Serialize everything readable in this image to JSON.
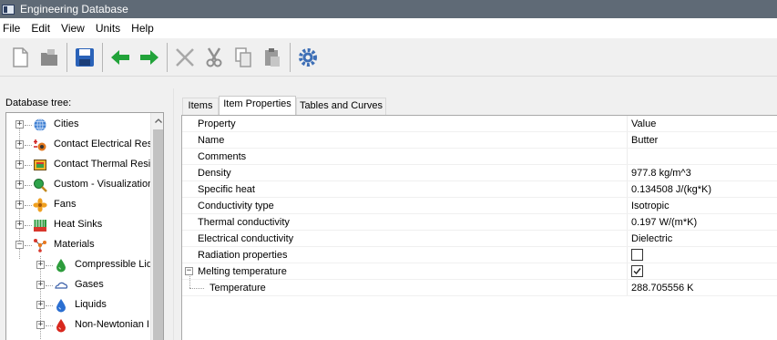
{
  "window": {
    "title": "Engineering Database"
  },
  "menu": {
    "items": [
      "File",
      "Edit",
      "View",
      "Units",
      "Help"
    ]
  },
  "toolbar": {
    "buttons": [
      "new-document-icon",
      "open-folder-icon",
      "save-icon",
      "back-arrow-icon",
      "forward-arrow-icon",
      "delete-icon",
      "cut-icon",
      "copy-icon",
      "paste-icon",
      "settings-gear-icon"
    ]
  },
  "tree": {
    "label": "Database tree:",
    "items": [
      {
        "label": "Cities",
        "icon": "globe-icon"
      },
      {
        "label": "Contact Electrical Res",
        "icon": "contact-electrical-icon"
      },
      {
        "label": "Contact Thermal Resi",
        "icon": "contact-thermal-icon"
      },
      {
        "label": "Custom - Visualization",
        "icon": "magnifier-icon"
      },
      {
        "label": "Fans",
        "icon": "fan-icon"
      },
      {
        "label": "Heat Sinks",
        "icon": "heat-sink-icon"
      },
      {
        "label": "Materials",
        "icon": "materials-icon"
      },
      {
        "label": "Compressible Liq",
        "icon": "green-drop-icon"
      },
      {
        "label": "Gases",
        "icon": "gas-cloud-icon"
      },
      {
        "label": "Liquids",
        "icon": "blue-drop-icon"
      },
      {
        "label": "Non-Newtonian I",
        "icon": "red-drop-icon"
      }
    ]
  },
  "tabs": [
    {
      "label": "Items"
    },
    {
      "label": "Item Properties",
      "active": true
    },
    {
      "label": "Tables and Curves"
    }
  ],
  "properties": {
    "header": {
      "name": "Property",
      "value": "Value"
    },
    "rows": [
      {
        "name": "Name",
        "value": "Butter"
      },
      {
        "name": "Comments",
        "value": ""
      },
      {
        "name": "Density",
        "value": "977.8 kg/m^3"
      },
      {
        "name": "Specific heat",
        "value": "0.134508 J/(kg*K)"
      },
      {
        "name": "Conductivity type",
        "value": "Isotropic"
      },
      {
        "name": "Thermal conductivity",
        "value": "0.197 W/(m*K)"
      },
      {
        "name": "Electrical conductivity",
        "value": "Dielectric"
      },
      {
        "name": "Radiation properties",
        "checked": false
      },
      {
        "name": "Melting temperature",
        "checked": true,
        "group": "expanded"
      },
      {
        "name": "Temperature",
        "value": "288.705556 K"
      }
    ]
  },
  "colors": {
    "titlebar": "#5f6a76",
    "arrow_green": "#22a33a",
    "save_blue": "#2a62b8"
  }
}
